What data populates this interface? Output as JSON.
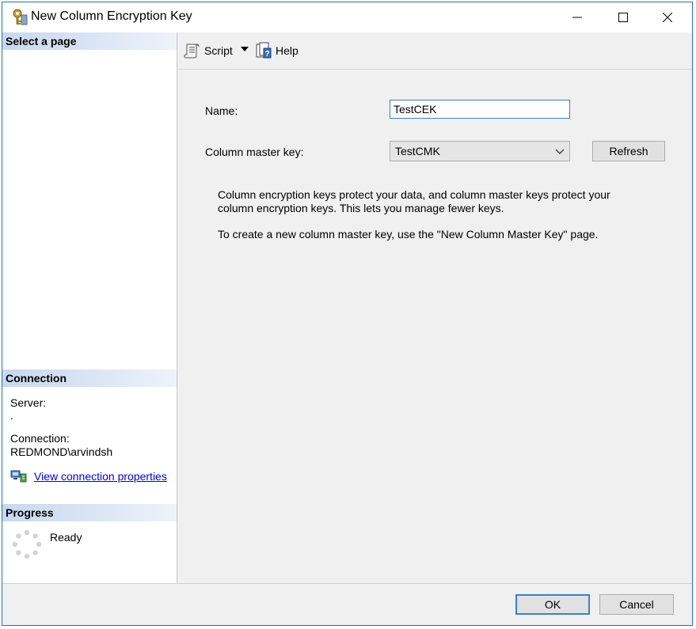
{
  "window": {
    "title": "New Column Encryption Key"
  },
  "sidebar": {
    "select_page_header": "Select a page",
    "connection_header": "Connection",
    "server_label": "Server:",
    "server_value": ".",
    "connection_label": "Connection:",
    "connection_value": "REDMOND\\arvindsh",
    "view_connection_link": "View connection properties",
    "progress_header": "Progress",
    "progress_status": "Ready"
  },
  "toolbar": {
    "script_label": "Script",
    "help_label": "Help"
  },
  "form": {
    "name_label": "Name:",
    "name_value": "TestCEK",
    "cmk_label": "Column master key:",
    "cmk_selected": "TestCMK",
    "refresh_label": "Refresh",
    "description_1": "Column encryption keys protect your data, and column master keys protect your column encryption keys. This lets you manage fewer keys.",
    "description_2": "To create a new column master key, use the \"New Column Master Key\" page."
  },
  "footer": {
    "ok_label": "OK",
    "cancel_label": "Cancel"
  }
}
